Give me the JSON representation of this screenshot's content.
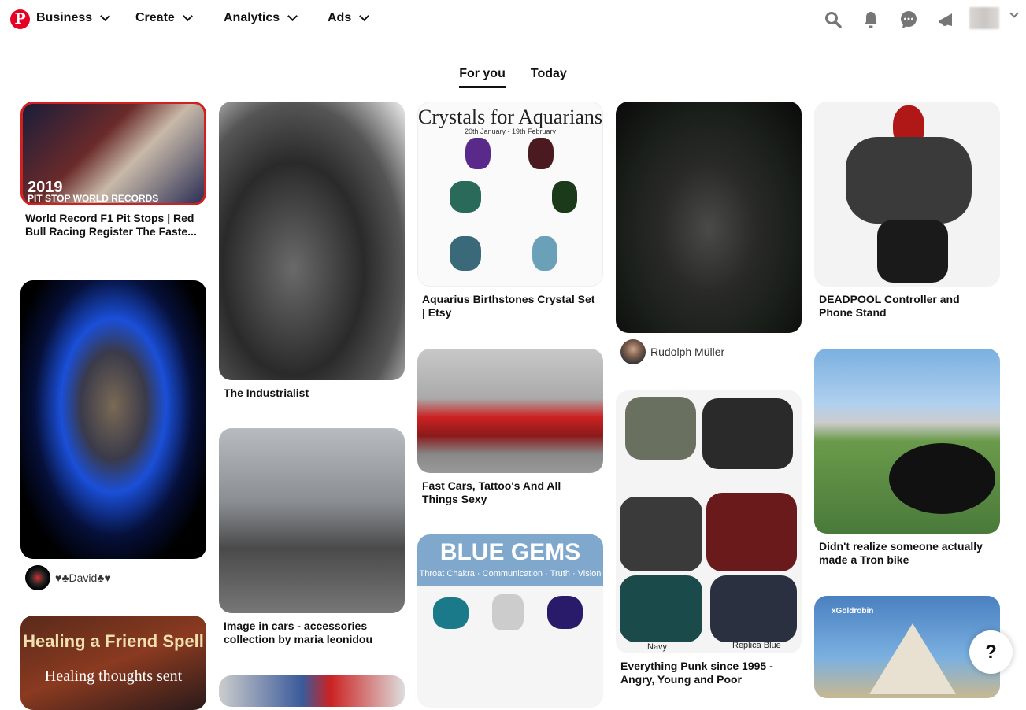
{
  "header": {
    "nav": [
      {
        "label": "Business"
      },
      {
        "label": "Create"
      },
      {
        "label": "Analytics"
      },
      {
        "label": "Ads"
      }
    ],
    "icons": [
      "search-icon",
      "bell-icon",
      "messages-icon",
      "megaphone-icon"
    ]
  },
  "tabs": [
    {
      "label": "For you",
      "active": true
    },
    {
      "label": "Today",
      "active": false
    }
  ],
  "pins": {
    "f1": {
      "caption": "World Record F1 Pit Stops | Red Bull Racing Register The Faste...",
      "overlay1": "2019",
      "overlay2": "PIT STOP WORLD RECORDS"
    },
    "skull": {
      "user": "♥♣David♣♥"
    },
    "healing": {
      "overlay1": "Healing a Friend Spell",
      "overlay2": "Healing thoughts sent"
    },
    "mercedes": {
      "caption": "The Industrialist"
    },
    "astonmartin": {
      "caption": "Image in cars - accessories collection by maria leonidou"
    },
    "crystals": {
      "caption": "Aquarius Birthstones Crystal Set | Etsy",
      "overlay1": "Crystals for Aquarians",
      "overlay2": "20th January - 19th February"
    },
    "mustang": {
      "caption": "Fast Cars, Tattoo's And All Things Sexy"
    },
    "bluegems": {
      "overlay1": "BLUE GEMS",
      "overlay2": "Throat Chakra · Communication · Truth · Vision"
    },
    "motorcycle": {
      "user": "Rudolph Müller"
    },
    "jackets": {
      "caption": "Everything Punk since 1995 - Angry, Young and Poor",
      "label1": "Navy",
      "label2": "Replica Blue"
    },
    "deadpool": {
      "caption": "DEADPOOL Controller and Phone Stand"
    },
    "tron": {
      "caption": "Didn't realize someone actually made a Tron bike"
    },
    "minecraft": {
      "overlay1": "xGoldrobin"
    }
  },
  "help": {
    "label": "?"
  }
}
